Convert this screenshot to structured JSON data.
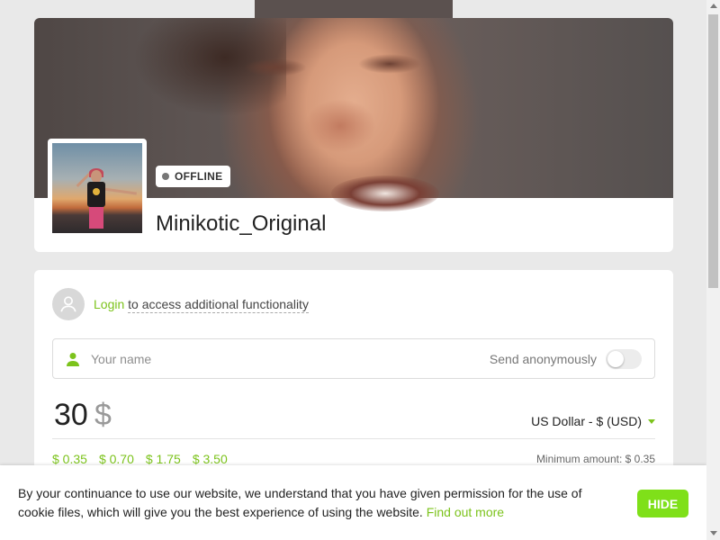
{
  "profile": {
    "status": "OFFLINE",
    "username": "Minikotic_Original"
  },
  "donation": {
    "login_link": "Login",
    "login_rest": "to access additional functionality",
    "name_placeholder": "Your name",
    "anonymous_label": "Send anonymously",
    "anonymous_enabled": false,
    "amount": "30",
    "currency_symbol": "$",
    "currency": "US Dollar - $ (USD)",
    "quick_amounts": [
      "$ 0.35",
      "$ 0.70",
      "$ 1.75",
      "$ 3.50"
    ],
    "minimum_amount": "Minimum amount: $ 0.35"
  },
  "cookie_notice": {
    "text": "By your continuance to use our website, we understand that you have given permission for the use of cookie files, which will give you the best experience of using the website.",
    "link": "Find out more",
    "hide_button": "HIDE"
  },
  "colors": {
    "accent": "#7cc31c",
    "hide_button": "#7fe019",
    "status_dot": "#777777"
  },
  "icons": {
    "user_placeholder": "user-circle-icon",
    "name_field": "person-icon",
    "currency_caret": "caret-down-icon"
  }
}
